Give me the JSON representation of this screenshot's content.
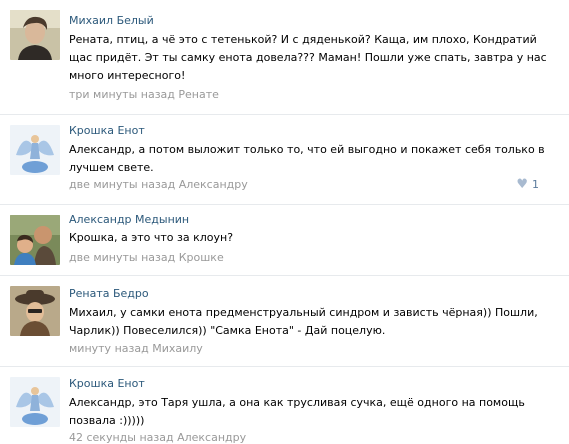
{
  "comments": [
    {
      "author": "Михаил Белый",
      "text": "Рената, птиц, а чё это с тетенькой? И с дяденькой? Каща, им плохо, Кондратий щас придёт. Эт ты самку енота довела??? Маман! Пошли уже спать, завтра у нас много интересного!",
      "time": "три минуты назад",
      "reply_to": "Ренате",
      "avatar_icon": "portrait-young-man-icon"
    },
    {
      "author": "Крошка Енот",
      "text": "Александр, а потом выложит только то, что ей выгодно и покажет себя только в лучшем свете.",
      "time": "две минуты назад",
      "reply_to": "Александру",
      "likes": "1",
      "avatar_icon": "fairy-figure-icon"
    },
    {
      "author": "Александр Медынин",
      "text": "Крошка, а это что за клоун?",
      "time": "две минуты назад",
      "reply_to": "Крошке",
      "avatar_icon": "man-and-child-icon"
    },
    {
      "author": "Рената Бедро",
      "text": "Михаил, у самки енота предменструальный синдром и зависть чёрная)) Пошли, Чарлик)) Повеселился)) \"Самка Енота\" - Дай поцелую.",
      "time": "минуту назад",
      "reply_to": "Михаилу",
      "avatar_icon": "woman-with-hat-icon"
    },
    {
      "author": "Крошка Енот",
      "text": "Александр, это Таря ушла, а она как трусливая сучка, ещё одного на помощь позвала :)))))",
      "time": "42 секунды назад",
      "reply_to": "Александру",
      "avatar_icon": "fairy-figure-icon"
    }
  ]
}
